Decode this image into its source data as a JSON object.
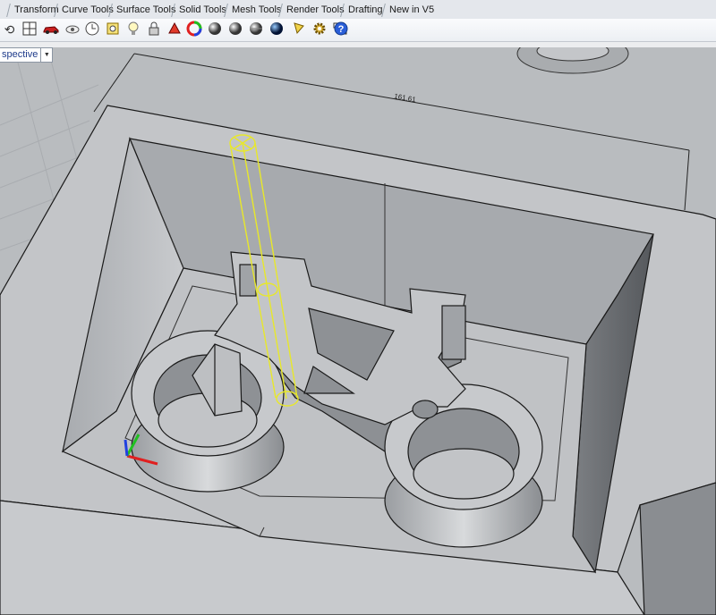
{
  "menu_tabs": [
    {
      "label": "Transform"
    },
    {
      "label": "Curve Tools"
    },
    {
      "label": "Surface Tools"
    },
    {
      "label": "Solid Tools"
    },
    {
      "label": "Mesh Tools"
    },
    {
      "label": "Render Tools"
    },
    {
      "label": "Drafting"
    },
    {
      "label": "New in V5"
    }
  ],
  "toolbar_icons": [
    "rotate-view-icon",
    "grid-icon",
    "car-icon",
    "hide-icon",
    "clock-icon",
    "snap-icon",
    "bulb-icon",
    "lock-icon",
    "material-icon",
    "color-wheel-icon",
    "sphere-shaded-icon",
    "sphere-render-icon",
    "sphere-rendered-icon",
    "globe-icon",
    "lamp-icon",
    "gear-icon",
    "layout-icon",
    "help-icon"
  ],
  "viewport": {
    "label": "spective",
    "dimension_label": "161.61"
  },
  "colors": {
    "viewport_bg": "#b9bcbf",
    "model_face": "#bfc1c4",
    "edge": "#1a1a1a",
    "selection": "#e8e82a",
    "axis_x": "#e02020",
    "axis_y": "#20c020",
    "axis_z": "#2040e0"
  }
}
